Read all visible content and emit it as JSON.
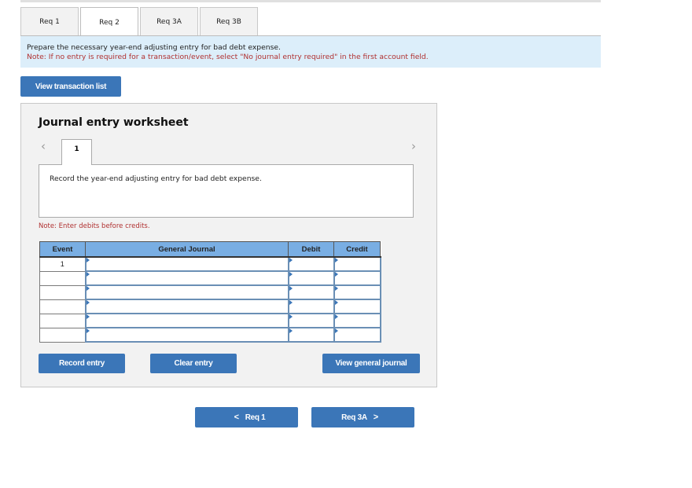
{
  "tabs": [
    {
      "label": "Req 1",
      "active": false
    },
    {
      "label": "Req 2",
      "active": true
    },
    {
      "label": "Req 3A",
      "active": false
    },
    {
      "label": "Req 3B",
      "active": false
    }
  ],
  "instructions": {
    "main": "Prepare the necessary year-end adjusting entry for bad debt expense.",
    "note": "Note: If no entry is required for a transaction/event, select \"No journal entry required\" in the first account field."
  },
  "view_transaction_list_label": "View transaction list",
  "worksheet": {
    "title": "Journal entry worksheet",
    "prev_icon": "‹",
    "next_icon": "›",
    "entry_tab": "1",
    "entry_description": "Record the year-end adjusting entry for bad debt expense.",
    "debits_note": "Note: Enter debits before credits.",
    "table": {
      "headers": [
        "Event",
        "General Journal",
        "Debit",
        "Credit"
      ],
      "rows": [
        {
          "event": "1",
          "account": "",
          "debit": "",
          "credit": ""
        },
        {
          "event": "",
          "account": "",
          "debit": "",
          "credit": ""
        },
        {
          "event": "",
          "account": "",
          "debit": "",
          "credit": ""
        },
        {
          "event": "",
          "account": "",
          "debit": "",
          "credit": ""
        },
        {
          "event": "",
          "account": "",
          "debit": "",
          "credit": ""
        },
        {
          "event": "",
          "account": "",
          "debit": "",
          "credit": ""
        }
      ]
    },
    "buttons": {
      "record": "Record entry",
      "clear": "Clear entry",
      "view_general_journal": "View general journal"
    }
  },
  "bottom_nav": {
    "prev_label": "Req 1",
    "next_label": "Req 3A",
    "prev_icon": "<",
    "next_icon": ">"
  },
  "colors": {
    "button": "#3b76b8",
    "header": "#79aee3",
    "instructions_bg": "#dceefa",
    "note_text": "#b03030"
  }
}
